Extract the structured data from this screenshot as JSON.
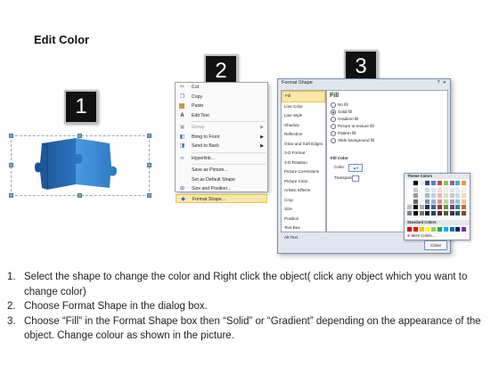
{
  "slide": {
    "title": "Edit Color"
  },
  "badges": [
    "1",
    "2",
    "3"
  ],
  "context_menu": {
    "items": [
      {
        "label": "Cut",
        "icon": "scissors-icon",
        "glyph": "✂",
        "underline_hint": "t"
      },
      {
        "label": "Copy",
        "icon": "copy-icon",
        "glyph": "❐"
      },
      {
        "label": "Paste",
        "icon": "paste-icon",
        "glyph": "📋"
      },
      {
        "label": "Edit Text",
        "icon": "edit-text-icon",
        "glyph": "A"
      },
      {
        "label": "Group",
        "icon": "group-icon",
        "glyph": "▣",
        "disabled": true,
        "submenu": true
      },
      {
        "label": "Bring to Front",
        "icon": "bring-front-icon",
        "glyph": "◧",
        "submenu": true
      },
      {
        "label": "Send to Back",
        "icon": "send-back-icon",
        "glyph": "◨",
        "submenu": true
      },
      {
        "label": "Hyperlink...",
        "icon": "hyperlink-icon",
        "glyph": "🔗"
      },
      {
        "label": "Save as Picture...",
        "icon": "",
        "glyph": ""
      },
      {
        "label": "Set as Default Shape",
        "icon": "",
        "glyph": ""
      },
      {
        "label": "Size and Position...",
        "icon": "size-position-icon",
        "glyph": "⊞"
      },
      {
        "label": "Format Shape...",
        "icon": "format-shape-icon",
        "glyph": "◆",
        "highlight": true
      }
    ]
  },
  "dialog": {
    "title": "Format Shape",
    "window_buttons": "? ✕",
    "nav": [
      "Fill",
      "Line Color",
      "Line Style",
      "Shadow",
      "Reflection",
      "Glow and Soft Edges",
      "3-D Format",
      "3-D Rotation",
      "Picture Corrections",
      "Picture Color",
      "Artistic Effects",
      "Crop",
      "Size",
      "Position",
      "Text Box",
      "Alt Text"
    ],
    "selected_nav": "Fill",
    "fill_heading": "Fill",
    "fill_options": [
      {
        "label": "No fill",
        "on": false
      },
      {
        "label": "Solid fill",
        "on": true
      },
      {
        "label": "Gradient fill",
        "on": false
      },
      {
        "label": "Picture or texture fill",
        "on": false
      },
      {
        "label": "Pattern fill",
        "on": false
      },
      {
        "label": "Slide background fill",
        "on": false
      }
    ],
    "fill_color_label": "Fill Color",
    "color_label": "Color:",
    "transparency_label": "Transparency:",
    "palette": {
      "theme_heading": "Theme Colors",
      "standard_heading": "Standard Colors",
      "more_colors": "More Colors...",
      "theme_top": [
        "#ffffff",
        "#000000",
        "#eeece1",
        "#1f497d",
        "#4f81bd",
        "#c0504d",
        "#9bbb59",
        "#8064a2",
        "#4bacc6",
        "#f79646"
      ],
      "standard": [
        "#c00000",
        "#ff0000",
        "#ffc000",
        "#ffff00",
        "#92d050",
        "#00b050",
        "#00b0f0",
        "#0070c0",
        "#002060",
        "#7030a0"
      ]
    },
    "close_label": "Close"
  },
  "instructions": [
    {
      "num": "1.",
      "text": "Select the shape to change the color and Right click the object( click any object which you want to change color)"
    },
    {
      "num": "2.",
      "text": "Choose Format Shape in the dialog box."
    },
    {
      "num": "3.",
      "text": "Choose “Fill” in the Format Shape box then “Solid” or “Gradient” depending on the appearance of the object. Change colour as shown in the picture."
    }
  ],
  "colors": {
    "puzzle_dark": "#1f5fa8",
    "puzzle_light": "#3d8fd6",
    "highlight": "#fbe8a6"
  }
}
